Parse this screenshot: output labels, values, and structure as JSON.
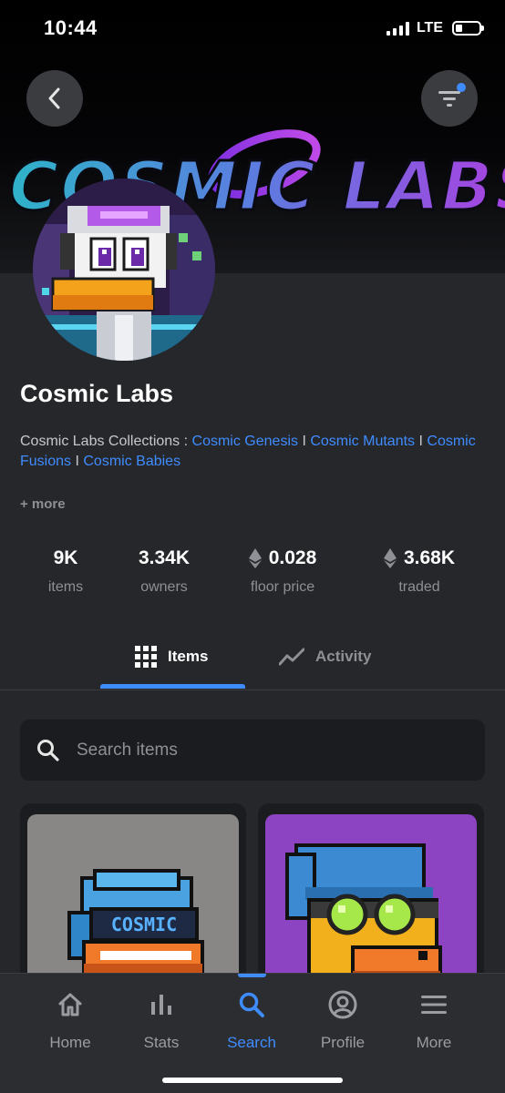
{
  "status_bar": {
    "time": "10:44",
    "network": "LTE"
  },
  "header": {
    "back_icon": "chevron-left-icon",
    "filter_icon": "filter-icon",
    "brand_logo_text": "COSMIC LABS"
  },
  "collection": {
    "title": "Cosmic Labs",
    "description_prefix": "Cosmic Labs Collections : ",
    "links": [
      "Cosmic Genesis",
      "Cosmic Mutants",
      "Cosmic Fusions",
      "Cosmic Babies"
    ],
    "separator": " I ",
    "more_label": "+ more"
  },
  "stats": [
    {
      "value": "9K",
      "label": "items",
      "eth": false
    },
    {
      "value": "3.34K",
      "label": "owners",
      "eth": false
    },
    {
      "value": "0.028",
      "label": "floor price",
      "eth": true
    },
    {
      "value": "3.68K",
      "label": "traded",
      "eth": true
    }
  ],
  "tabs": [
    {
      "label": "Items",
      "icon": "grid-icon",
      "active": true
    },
    {
      "label": "Activity",
      "icon": "trend-line-icon",
      "active": false
    }
  ],
  "search": {
    "placeholder": "Search items"
  },
  "cards": [
    {
      "background": "#898785",
      "visor_text": "COSMIC"
    },
    {
      "background": "#8c44c2"
    }
  ],
  "bottom_nav": [
    {
      "label": "Home",
      "icon": "home-icon",
      "active": false
    },
    {
      "label": "Stats",
      "icon": "bar-chart-icon",
      "active": false
    },
    {
      "label": "Search",
      "icon": "search-icon",
      "active": true
    },
    {
      "label": "Profile",
      "icon": "profile-icon",
      "active": false
    },
    {
      "label": "More",
      "icon": "menu-icon",
      "active": false
    }
  ],
  "colors": {
    "accent": "#3f8cff",
    "background": "#25272b",
    "muted": "#8e9095"
  }
}
